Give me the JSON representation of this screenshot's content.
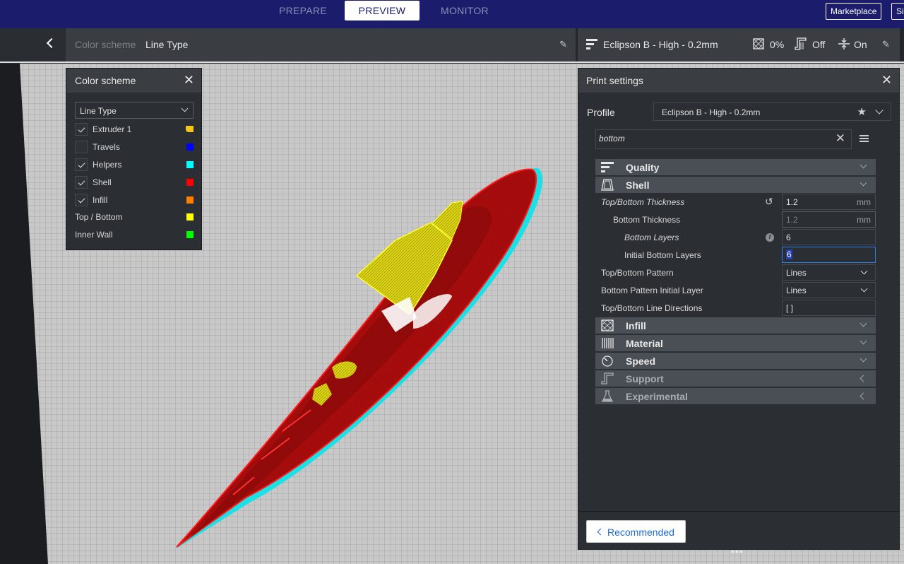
{
  "nav": {
    "tabs": [
      {
        "label": "PREPARE"
      },
      {
        "label": "PREVIEW"
      },
      {
        "label": "MONITOR"
      }
    ],
    "marketplace_label": "Marketplace",
    "signin_label": "Sig"
  },
  "header": {
    "color_scheme_label": "Color scheme",
    "color_scheme_value": "Line Type",
    "profile_name": "Eclipson B - High - 0.2mm",
    "infill_value": "0%",
    "support_value": "Off",
    "adhesion_value": "On"
  },
  "color_scheme_panel": {
    "title": "Color scheme",
    "selected": "Line Type",
    "items": [
      {
        "label": "Extruder 1",
        "checked": true,
        "color": "#f5c518",
        "checkbox": true
      },
      {
        "label": "Travels",
        "checked": false,
        "color": "#0000ff",
        "checkbox": true
      },
      {
        "label": "Helpers",
        "checked": true,
        "color": "#00ffff",
        "checkbox": true
      },
      {
        "label": "Shell",
        "checked": true,
        "color": "#ff0000",
        "checkbox": true
      },
      {
        "label": "Infill",
        "checked": true,
        "color": "#ff8000",
        "checkbox": true
      },
      {
        "label": "Top / Bottom",
        "checked": false,
        "color": "#ffff00",
        "checkbox": false
      },
      {
        "label": "Inner Wall",
        "checked": false,
        "color": "#00ff00",
        "checkbox": false
      }
    ]
  },
  "print_settings": {
    "title": "Print settings",
    "profile_label": "Profile",
    "profile_value": "Eclipson B - High - 0.2mm",
    "search_value": "bottom",
    "categories": {
      "quality": "Quality",
      "shell": "Shell",
      "infill": "Infill",
      "material": "Material",
      "speed": "Speed",
      "support": "Support",
      "experimental": "Experimental"
    },
    "settings": {
      "top_bottom_thickness": {
        "label": "Top/Bottom Thickness",
        "value": "1.2",
        "unit": "mm"
      },
      "bottom_thickness": {
        "label": "Bottom Thickness",
        "value": "1.2",
        "unit": "mm"
      },
      "bottom_layers": {
        "label": "Bottom Layers",
        "value": "6"
      },
      "initial_bottom_layers": {
        "label": "Initial Bottom Layers",
        "value": "6"
      },
      "top_bottom_pattern": {
        "label": "Top/Bottom Pattern",
        "value": "Lines"
      },
      "bottom_pattern_initial_layer": {
        "label": "Bottom Pattern Initial Layer",
        "value": "Lines"
      },
      "top_bottom_line_directions": {
        "label": "Top/Bottom Line Directions",
        "value": "[ ]"
      }
    },
    "recommended_label": "Recommended"
  },
  "colors": {
    "nav_bg": "#1b1c6b",
    "accent_blue": "#2b7de9",
    "shell_red": "#ff0000",
    "top_bottom_yellow": "#ffff00",
    "helper_cyan": "#00ffff"
  }
}
